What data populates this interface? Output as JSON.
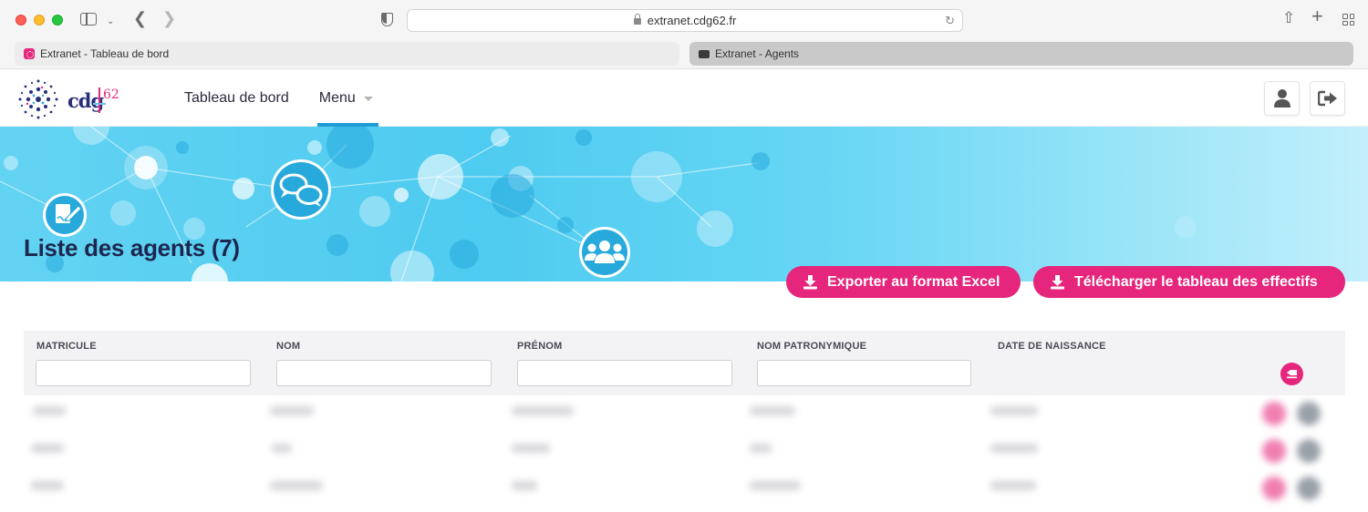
{
  "browser": {
    "url": "extranet.cdg62.fr",
    "tabs": [
      {
        "label": "Extranet - Tableau de bord"
      },
      {
        "label": "Extranet - Agents"
      }
    ]
  },
  "logo": {
    "text": "cdg",
    "number": "62"
  },
  "nav": {
    "items": [
      {
        "label": "Tableau de bord"
      },
      {
        "label": "Menu"
      }
    ]
  },
  "page": {
    "title": "Liste des agents (7)"
  },
  "actions": {
    "export_excel": "Exporter au format Excel",
    "download_effectifs": "Télécharger le tableau des effectifs"
  },
  "table": {
    "columns": [
      {
        "label": "MATRICULE"
      },
      {
        "label": "NOM"
      },
      {
        "label": "PRÉNOM"
      },
      {
        "label": "NOM PATRONYMIQUE"
      },
      {
        "label": "DATE DE NAISSANCE"
      }
    ],
    "filters": [
      "",
      "",
      "",
      ""
    ]
  },
  "colors": {
    "accent": "#e6267c",
    "nav_active": "#1f9bd6",
    "title": "#1d2750",
    "banner": "#4ecbf0"
  },
  "icons": {
    "banner": [
      "document-edit-icon",
      "chat-bubbles-icon",
      "users-group-icon"
    ],
    "header": [
      "user-icon",
      "logout-icon"
    ],
    "actions": [
      "download-icon",
      "eraser-icon"
    ]
  }
}
